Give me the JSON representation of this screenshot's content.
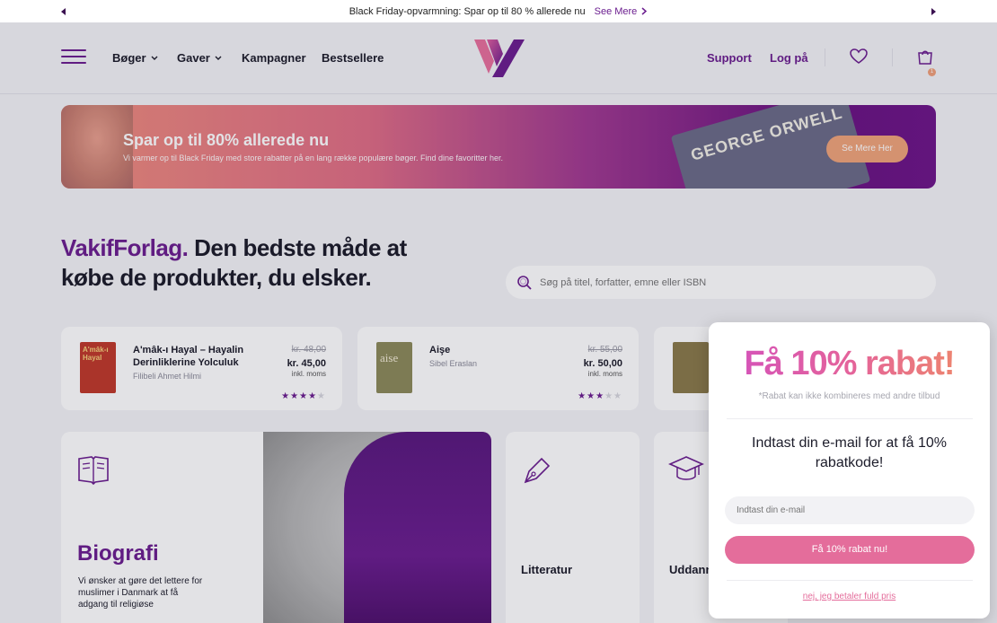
{
  "announcement": {
    "text": "Black Friday-opvarmning: Spar op til 80 % allerede nu",
    "link": "See Mere"
  },
  "header": {
    "nav": [
      {
        "label": "Bøger",
        "has_dropdown": true
      },
      {
        "label": "Gaver",
        "has_dropdown": true
      },
      {
        "label": "Kampagner",
        "has_dropdown": false
      },
      {
        "label": "Bestsellere",
        "has_dropdown": false
      }
    ],
    "support": "Support",
    "login": "Log på",
    "cart_count": "1"
  },
  "banner": {
    "title": "Spar op til 80% allerede nu",
    "subtitle": "Vi varmer op til Black Friday med store rabatter på en lang række populære bøger. Find dine favoritter her.",
    "button": "Se Mere Her",
    "book_text": "GEORGE ORWELL"
  },
  "hero": {
    "brand": "VakifForlag.",
    "headline": " Den bedste måde at købe de produkter, du elsker."
  },
  "search": {
    "placeholder": "Søg på titel, forfatter, emne eller ISBN"
  },
  "products": [
    {
      "title": "A'mâk-ı Hayal – Hayalin Derinliklerine Yolculuk",
      "author": "Filibeli Ahmet Hilmi",
      "old_price": "kr. 48,00",
      "price": "kr. 45,00",
      "vat": "inkl. moms",
      "rating": 4.5,
      "stars_on": "★★★★",
      "stars_off": "★",
      "cover_color": "#c0392b",
      "cover_text": "A'mâk-ı Hayal"
    },
    {
      "title": "Aişe",
      "author": "Sibel Eraslan",
      "old_price": "kr. 55,00",
      "price": "kr. 50,00",
      "vat": "inkl. moms",
      "rating": 3,
      "stars_on": "★★★",
      "stars_off": "★★",
      "cover_color": "#8c8a5a",
      "cover_text": "aise"
    }
  ],
  "categories": {
    "biography": {
      "title": "Biografi",
      "text": "Vi ønsker at gøre det lettere for muslimer i Danmark at få adgang til religiøse"
    },
    "literature": "Litteratur",
    "education": "Uddann"
  },
  "popup": {
    "title": "Få 10% rabat!",
    "note": "*Rabat kan ikke kombineres med andre tilbud",
    "prompt": "Indtast din e-mail for at få 10% rabatkode!",
    "email_placeholder": "Indtast din e-mail",
    "submit": "Få 10% rabat nu!",
    "decline": "nej, jeg betaler fuld pris"
  },
  "colors": {
    "brand_purple": "#6b1e8f",
    "accent_pink": "#e46d9b",
    "accent_orange": "#f0a47a"
  }
}
